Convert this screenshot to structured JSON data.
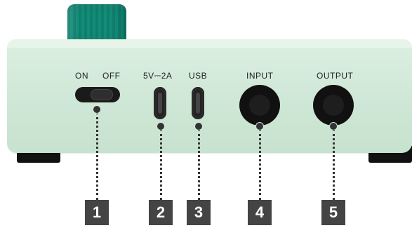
{
  "labels": {
    "switch_on": "ON",
    "switch_off": "OFF",
    "power": "5V⎓2A",
    "usb": "USB",
    "input": "INPUT",
    "output": "OUTPUT"
  },
  "callouts": [
    "1",
    "2",
    "3",
    "4",
    "5"
  ],
  "colors": {
    "device_body": "#cfe7d6",
    "knob": "#138c78",
    "badge": "#444444",
    "feet": "#111111"
  }
}
